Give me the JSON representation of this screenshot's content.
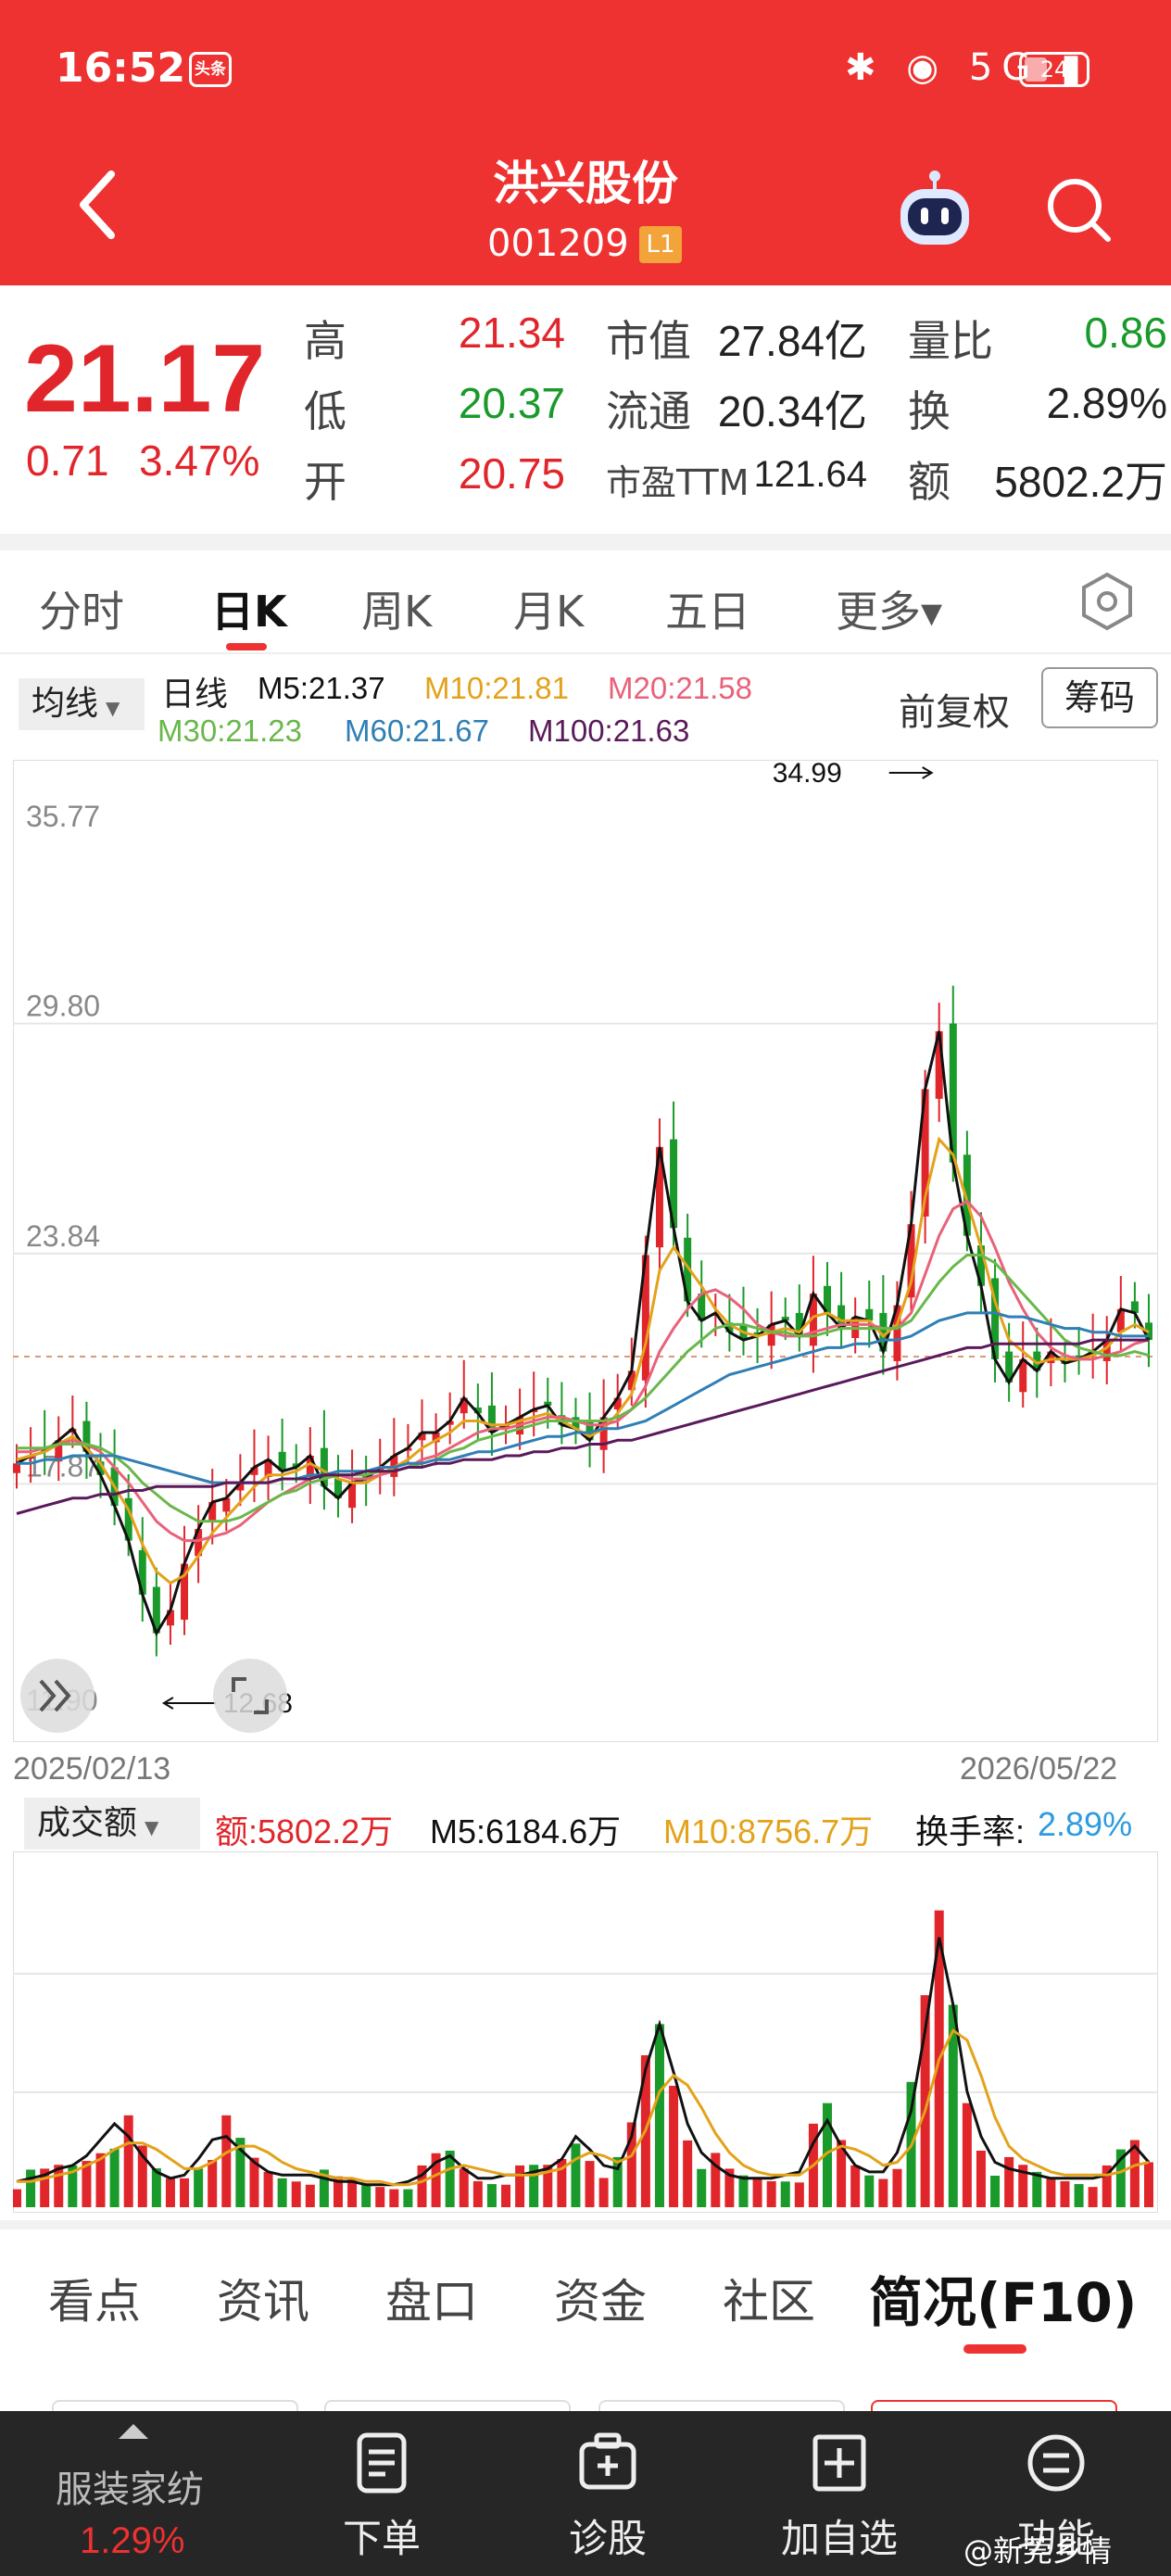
{
  "status_bar": {
    "time": "16:52",
    "badge": "头条",
    "icons": "✱ ◉ 5G ▮",
    "battery": "24"
  },
  "header": {
    "title": "洪兴股份",
    "code": "001209",
    "level": "L1"
  },
  "quote": {
    "price": "21.17",
    "change": "0.71",
    "change_pct": "3.47%",
    "high_label": "高",
    "high": "21.34",
    "low_label": "低",
    "low": "20.37",
    "open_label": "开",
    "open": "20.75",
    "mcap_label": "市值",
    "mcap": "27.84亿",
    "float_label": "流通",
    "float": "20.34亿",
    "pe_label": "市盈TTM",
    "pe": "121.64",
    "vr_label": "量比",
    "vr": "0.86",
    "turnover_label": "换",
    "turnover": "2.89%",
    "amount_label": "额",
    "amount": "5802.2万"
  },
  "period_tabs": [
    "分时",
    "日K",
    "周K",
    "月K",
    "五日",
    "更多▾"
  ],
  "ma": {
    "dropdown": "均线",
    "period": "日线",
    "m5": "M5:21.37",
    "m10": "M10:21.81",
    "m20": "M20:21.58",
    "m30": "M30:21.23",
    "m60": "M60:21.67",
    "m100": "M100:21.63",
    "adjust": "前复权",
    "chips": "筹码"
  },
  "colors": {
    "up": "#e1262b",
    "down": "#1a9a2a",
    "m5": "#111111",
    "m10": "#e3a21a",
    "m20": "#e8627a",
    "m30": "#68b84a",
    "m60": "#2f7fb5",
    "m100": "#5a1a5a"
  },
  "chart_data": [
    {
      "type": "candlestick",
      "title": "日K",
      "y_ticks": [
        "35.77",
        "29.80",
        "23.84",
        "17.87",
        "11.90"
      ],
      "ylim": [
        11.9,
        35.77
      ],
      "x_start": "2025/02/13",
      "x_end": "2026/05/22",
      "high_annotation": "34.99",
      "low_annotation": "12.68",
      "last_price": 21.17,
      "series": [
        {
          "name": "M5",
          "values": [
            18.4,
            18.6,
            18.7,
            19.0,
            19.3,
            18.7,
            18.1,
            17.3,
            16.4,
            15.0,
            14.0,
            14.6,
            15.8,
            16.7,
            17.4,
            17.5,
            17.9,
            18.3,
            18.5,
            18.2,
            18.3,
            18.6,
            17.8,
            17.5,
            17.9,
            18.0,
            18.3,
            18.6,
            18.8,
            19.2,
            19.2,
            19.5,
            20.1,
            19.7,
            19.2,
            19.4,
            19.6,
            19.8,
            19.9,
            19.4,
            19.3,
            19.0,
            19.6,
            20.1,
            20.8,
            23.8,
            26.6,
            24.5,
            22.6,
            22.1,
            22.3,
            21.8,
            21.6,
            21.7,
            22.0,
            22.1,
            21.7,
            22.8,
            22.3,
            21.9,
            22.2,
            22.1,
            21.3,
            22.5,
            24.6,
            28.1,
            29.6,
            26.2,
            24.3,
            23.0,
            21.1,
            20.5,
            21.1,
            20.8,
            21.3,
            21.0,
            21.1,
            21.3,
            21.6,
            22.4,
            22.3,
            21.6
          ]
        },
        {
          "name": "M10",
          "values": [
            18.5,
            18.6,
            18.7,
            18.9,
            19.1,
            18.8,
            18.4,
            17.8,
            17.2,
            16.3,
            15.6,
            15.3,
            15.5,
            16.0,
            16.6,
            17.0,
            17.4,
            17.8,
            18.1,
            18.1,
            18.2,
            18.4,
            18.2,
            18.0,
            17.9,
            17.9,
            18.1,
            18.3,
            18.5,
            18.8,
            19.0,
            19.2,
            19.5,
            19.5,
            19.4,
            19.4,
            19.5,
            19.6,
            19.7,
            19.5,
            19.3,
            19.1,
            19.3,
            19.7,
            20.2,
            21.5,
            23.4,
            24.0,
            23.5,
            23.0,
            22.4,
            22.0,
            21.8,
            21.7,
            21.8,
            21.9,
            21.8,
            22.2,
            22.3,
            22.1,
            22.1,
            22.1,
            21.7,
            22.0,
            23.1,
            25.3,
            26.8,
            26.4,
            25.2,
            24.0,
            22.6,
            21.6,
            21.3,
            21.0,
            21.1,
            21.1,
            21.1,
            21.2,
            21.4,
            21.8,
            22.0,
            21.8
          ]
        },
        {
          "name": "M20",
          "values": [
            18.7,
            18.7,
            18.8,
            18.9,
            19.0,
            18.9,
            18.7,
            18.3,
            17.9,
            17.4,
            16.9,
            16.6,
            16.4,
            16.4,
            16.5,
            16.6,
            16.8,
            17.1,
            17.4,
            17.6,
            17.8,
            18.0,
            18.1,
            18.1,
            18.0,
            18.0,
            18.1,
            18.2,
            18.3,
            18.5,
            18.6,
            18.8,
            19.0,
            19.2,
            19.3,
            19.3,
            19.4,
            19.5,
            19.6,
            19.6,
            19.5,
            19.4,
            19.4,
            19.5,
            19.8,
            20.4,
            21.3,
            21.9,
            22.4,
            22.8,
            22.9,
            22.7,
            22.4,
            22.0,
            21.8,
            21.7,
            21.7,
            21.8,
            21.9,
            22.0,
            22.0,
            22.0,
            21.9,
            21.9,
            22.3,
            23.3,
            24.3,
            25.0,
            25.2,
            24.8,
            24.0,
            23.1,
            22.4,
            21.8,
            21.4,
            21.2,
            21.1,
            21.1,
            21.2,
            21.3,
            21.5,
            21.6
          ]
        },
        {
          "name": "M30",
          "values": [
            18.8,
            18.8,
            18.8,
            18.9,
            18.9,
            18.9,
            18.8,
            18.6,
            18.3,
            17.9,
            17.6,
            17.3,
            17.1,
            16.9,
            16.9,
            16.9,
            17.0,
            17.2,
            17.4,
            17.6,
            17.7,
            17.9,
            18.0,
            18.1,
            18.1,
            18.1,
            18.2,
            18.2,
            18.3,
            18.4,
            18.5,
            18.7,
            18.8,
            19.0,
            19.1,
            19.2,
            19.3,
            19.4,
            19.5,
            19.5,
            19.5,
            19.5,
            19.5,
            19.6,
            19.8,
            20.1,
            20.5,
            20.9,
            21.3,
            21.6,
            21.9,
            22.0,
            22.0,
            21.9,
            21.8,
            21.8,
            21.7,
            21.7,
            21.8,
            21.9,
            21.9,
            21.9,
            21.9,
            21.9,
            22.1,
            22.6,
            23.1,
            23.5,
            23.8,
            23.8,
            23.6,
            23.2,
            22.8,
            22.4,
            22.0,
            21.6,
            21.4,
            21.3,
            21.2,
            21.2,
            21.3,
            21.2
          ]
        },
        {
          "name": "M60",
          "values": [
            18.4,
            18.4,
            18.5,
            18.5,
            18.6,
            18.6,
            18.6,
            18.6,
            18.5,
            18.4,
            18.3,
            18.2,
            18.1,
            18.0,
            17.9,
            17.9,
            17.9,
            17.9,
            17.9,
            18.0,
            18.0,
            18.1,
            18.1,
            18.2,
            18.2,
            18.2,
            18.3,
            18.3,
            18.4,
            18.4,
            18.5,
            18.5,
            18.6,
            18.7,
            18.7,
            18.8,
            18.9,
            19.0,
            19.1,
            19.1,
            19.2,
            19.2,
            19.3,
            19.3,
            19.4,
            19.5,
            19.7,
            19.9,
            20.1,
            20.3,
            20.5,
            20.7,
            20.8,
            20.9,
            21.0,
            21.1,
            21.2,
            21.3,
            21.4,
            21.4,
            21.5,
            21.5,
            21.6,
            21.6,
            21.7,
            21.9,
            22.1,
            22.2,
            22.3,
            22.3,
            22.3,
            22.2,
            22.2,
            22.1,
            22.0,
            21.9,
            21.9,
            21.8,
            21.8,
            21.7,
            21.7,
            21.7
          ]
        },
        {
          "name": "M100",
          "values": [
            17.1,
            17.2,
            17.3,
            17.4,
            17.5,
            17.5,
            17.6,
            17.6,
            17.7,
            17.7,
            17.8,
            17.8,
            17.8,
            17.8,
            17.8,
            17.9,
            17.9,
            17.9,
            17.9,
            18.0,
            18.0,
            18.0,
            18.1,
            18.1,
            18.1,
            18.2,
            18.2,
            18.2,
            18.3,
            18.3,
            18.4,
            18.4,
            18.5,
            18.5,
            18.5,
            18.6,
            18.6,
            18.7,
            18.7,
            18.8,
            18.8,
            18.9,
            18.9,
            19.0,
            19.0,
            19.1,
            19.2,
            19.3,
            19.4,
            19.5,
            19.6,
            19.7,
            19.8,
            19.9,
            20.0,
            20.1,
            20.2,
            20.3,
            20.4,
            20.5,
            20.6,
            20.7,
            20.8,
            20.9,
            21.0,
            21.1,
            21.2,
            21.3,
            21.4,
            21.4,
            21.5,
            21.5,
            21.5,
            21.5,
            21.5,
            21.5,
            21.5,
            21.6,
            21.6,
            21.6,
            21.6,
            21.6
          ]
        }
      ]
    },
    {
      "type": "bar",
      "title": "成交额",
      "amount": "额:5802.2万",
      "m5": "M5:6184.6万",
      "m10": "M10:8756.7万",
      "turnover_label": "换手率:",
      "turnover": "2.89%",
      "series": [
        {
          "name": "M5",
          "values": [
            0.8,
            0.9,
            1.0,
            1.2,
            1.3,
            1.6,
            2.1,
            2.6,
            2.2,
            1.6,
            1.1,
            0.9,
            1.0,
            1.5,
            2.1,
            2.2,
            1.8,
            1.4,
            1.1,
            1.0,
            1.0,
            1.0,
            0.9,
            0.8,
            0.8,
            0.7,
            0.7,
            0.7,
            0.8,
            1.0,
            1.4,
            1.6,
            1.2,
            0.9,
            0.9,
            1.0,
            1.0,
            1.1,
            1.2,
            1.5,
            2.2,
            1.8,
            1.3,
            1.2,
            2.2,
            4.3,
            5.7,
            4.2,
            2.6,
            1.7,
            1.3,
            1.0,
            0.9,
            0.9,
            0.9,
            1.0,
            1.1,
            2.0,
            2.7,
            1.9,
            1.3,
            1.1,
            1.1,
            1.7,
            3.0,
            5.5,
            8.4,
            6.3,
            3.6,
            2.2,
            1.4,
            1.2,
            1.1,
            1.0,
            0.9,
            0.9,
            0.9,
            0.9,
            1.0,
            1.5,
            1.9,
            1.4
          ]
        },
        {
          "name": "M10",
          "values": [
            0.8,
            0.8,
            0.9,
            1.0,
            1.1,
            1.3,
            1.5,
            1.8,
            2.0,
            2.0,
            1.8,
            1.5,
            1.2,
            1.2,
            1.4,
            1.7,
            1.9,
            1.9,
            1.7,
            1.4,
            1.2,
            1.1,
            1.0,
            0.9,
            0.9,
            0.8,
            0.8,
            0.7,
            0.7,
            0.8,
            1.0,
            1.2,
            1.3,
            1.2,
            1.1,
            1.0,
            1.0,
            1.0,
            1.1,
            1.2,
            1.5,
            1.7,
            1.6,
            1.4,
            1.6,
            2.4,
            3.6,
            4.1,
            3.8,
            3.1,
            2.3,
            1.7,
            1.3,
            1.1,
            1.0,
            1.0,
            1.0,
            1.3,
            1.7,
            1.9,
            1.8,
            1.6,
            1.3,
            1.4,
            1.9,
            3.0,
            4.6,
            5.5,
            5.2,
            4.1,
            2.8,
            1.9,
            1.5,
            1.3,
            1.1,
            1.0,
            1.0,
            1.0,
            1.0,
            1.1,
            1.3,
            1.4
          ]
        }
      ]
    }
  ],
  "f10_tabs": [
    "看点",
    "资讯",
    "盘口",
    "资金",
    "社区",
    "简况(F10)"
  ],
  "bottom_bar": {
    "sector": "服装家纺",
    "sector_pct": "1.29%",
    "items": [
      "下单",
      "诊股",
      "加自选",
      "功能"
    ]
  },
  "watermark": "@新莞乡情"
}
